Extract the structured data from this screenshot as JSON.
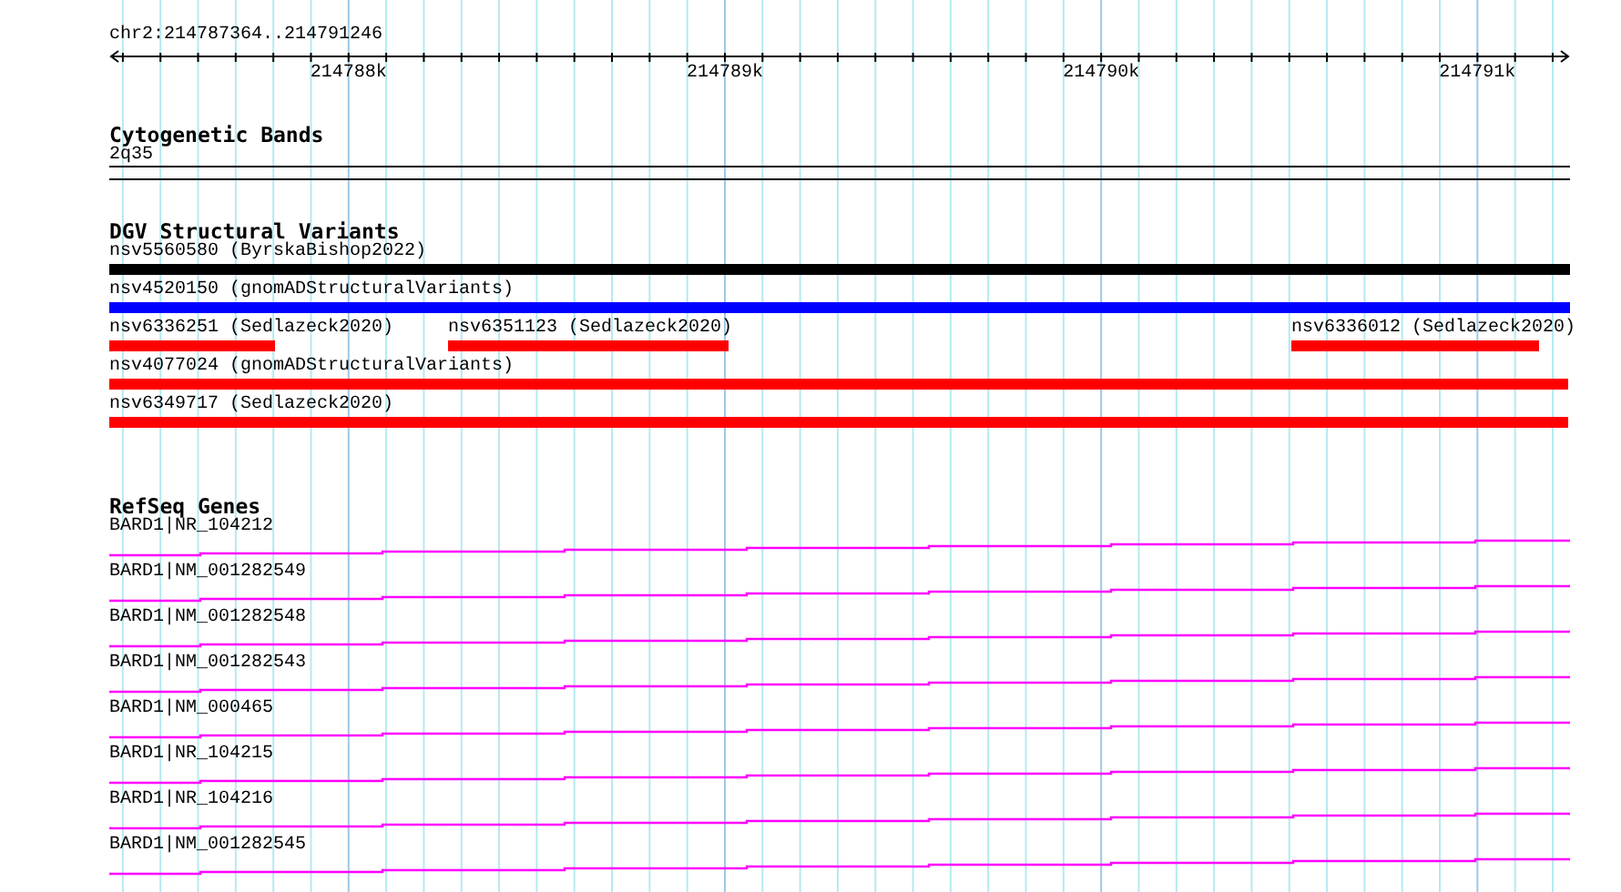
{
  "ruler": {
    "location": "chr2:214787364..214791246",
    "tick_labels": [
      "214788k",
      "214789k",
      "214790k",
      "214791k"
    ]
  },
  "tracks": [
    {
      "kind": "bands",
      "title": "Cytogenetic Bands",
      "features": [
        {
          "label": "2q35"
        }
      ]
    },
    {
      "kind": "variants",
      "title": "DGV Structural Variants",
      "rows": [
        [
          {
            "label": "nsv5560580 (ByrskaBishop2022)",
            "color": "#000000"
          }
        ],
        [
          {
            "label": "nsv4520150 (gnomADStructuralVariants)",
            "color": "#0000ff"
          }
        ],
        [
          {
            "label": "nsv6336251 (Sedlazeck2020)",
            "color": "#ff0000"
          },
          {
            "label": "nsv6351123 (Sedlazeck2020)",
            "color": "#ff0000"
          },
          {
            "label": "nsv6336012 (Sedlazeck2020)",
            "color": "#ff0000"
          }
        ],
        [
          {
            "label": "nsv4077024 (gnomADStructuralVariants)",
            "color": "#ff0000"
          }
        ],
        [
          {
            "label": "nsv6349717 (Sedlazeck2020)",
            "color": "#ff0000"
          }
        ]
      ]
    },
    {
      "kind": "genes",
      "title": "RefSeq Genes",
      "genes": [
        {
          "label": "BARD1|NR_104212"
        },
        {
          "label": "BARD1|NM_001282549"
        },
        {
          "label": "BARD1|NM_001282548"
        },
        {
          "label": "BARD1|NM_001282543"
        },
        {
          "label": "BARD1|NM_000465"
        },
        {
          "label": "BARD1|NR_104215"
        },
        {
          "label": "BARD1|NR_104216"
        },
        {
          "label": "BARD1|NM_001282545"
        }
      ]
    }
  ]
}
